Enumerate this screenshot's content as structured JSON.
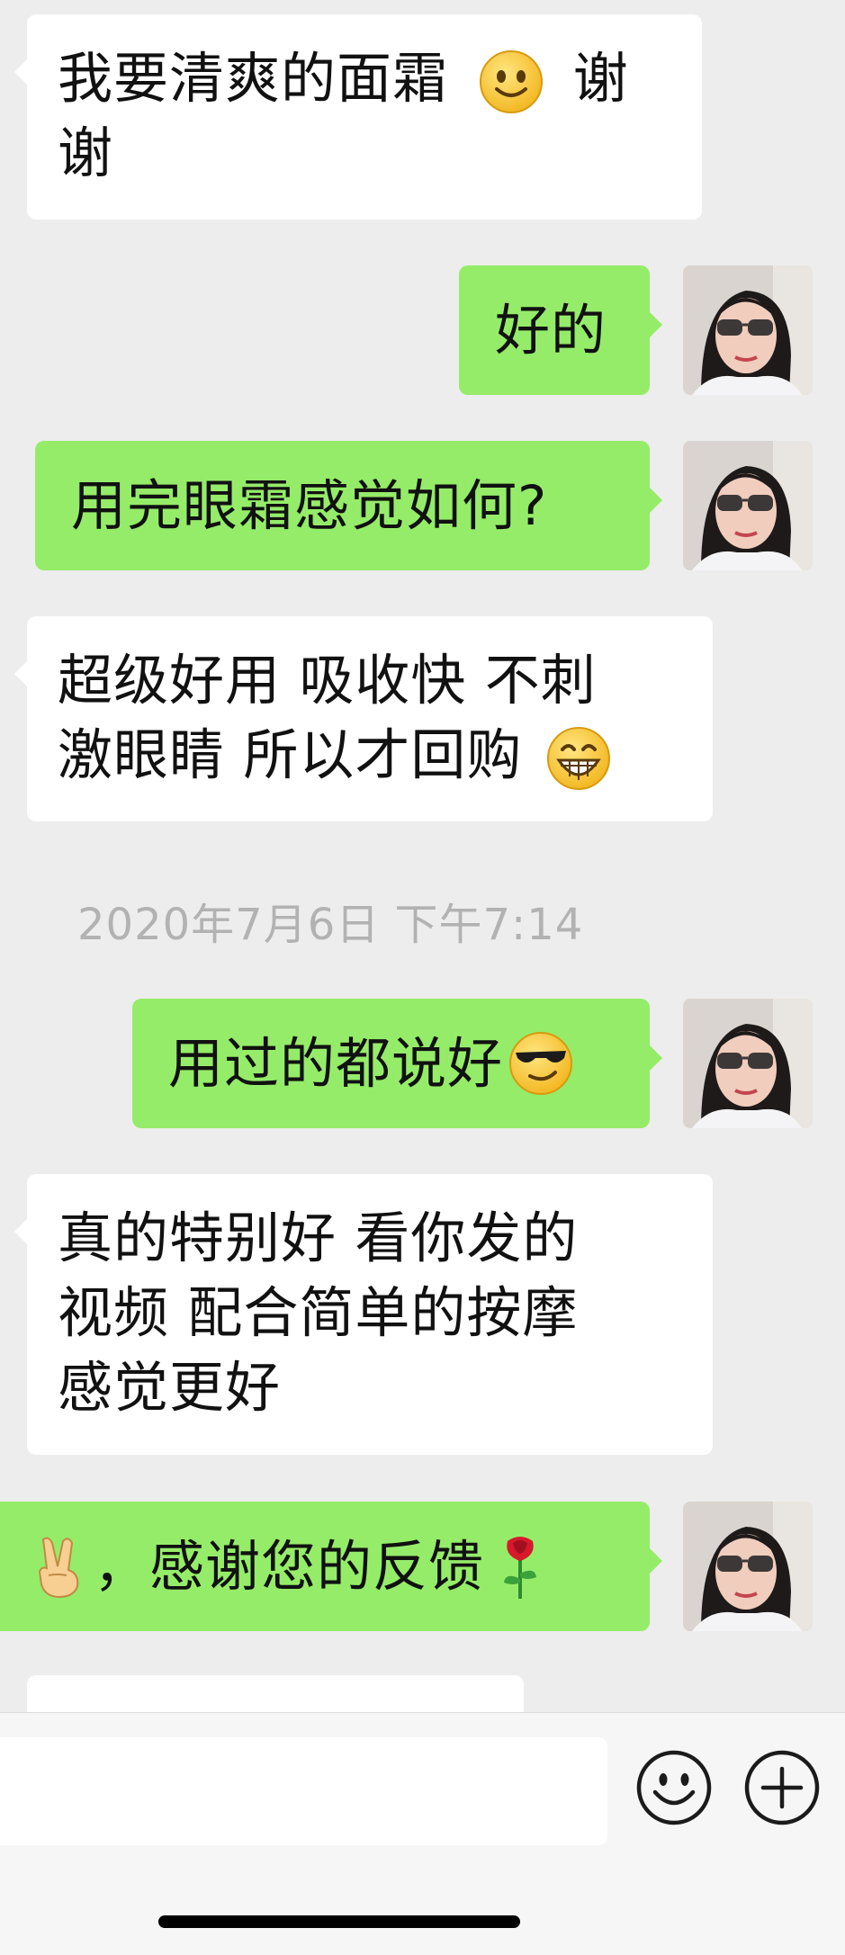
{
  "messages": {
    "m1": {
      "line1": "我要清爽的面霜",
      "line1_tail": "谢",
      "line2": "谢"
    },
    "m2": {
      "text": "好的"
    },
    "m3": {
      "text": "用完眼霜感觉如何?"
    },
    "m4": {
      "line1": "超级好用  吸收快  不刺",
      "line2": "激眼睛  所以才回购"
    },
    "timestamp": "2020年7月6日 下午7:14",
    "m5": {
      "text": "用过的都说好"
    },
    "m6": {
      "line1": "真的特别好  看你发的",
      "line2": "视频  配合简单的按摩",
      "line3": "感觉更好"
    },
    "m7": {
      "text": "，感谢您的反馈"
    }
  },
  "colors": {
    "background": "#ededed",
    "incoming_bubble": "#ffffff",
    "outgoing_bubble": "#95ec69",
    "timestamp": "#b2b2b2"
  },
  "icons": {
    "emoji_smile": "smile-emoji",
    "emoji_grin": "grin-emoji",
    "emoji_cool": "sunglasses-emoji",
    "emoji_victory": "victory-hand-emoji",
    "emoji_rose": "rose-emoji",
    "emoji_button": "smiley-face-icon",
    "plus_button": "plus-circle-icon"
  }
}
